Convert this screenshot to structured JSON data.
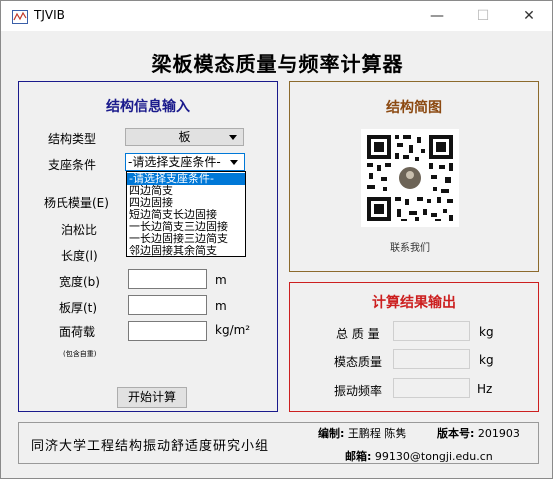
{
  "window": {
    "title": "TJVIB",
    "min_glyph": "—",
    "max_glyph": "☐",
    "close_glyph": "✕"
  },
  "main_title": "梁板模态质量与频率计算器",
  "input_panel": {
    "title": "结构信息输入",
    "structure_type_label": "结构类型",
    "structure_type_value": "板",
    "support_label": "支座条件",
    "support_value": "-请选择支座条件-",
    "support_options": [
      "-请选择支座条件-",
      "四边简支",
      "四边固接",
      "短边简支长边固接",
      "一长边简支三边固接",
      "一长边固接三边简支",
      "邻边固接其余简支"
    ],
    "youngs_label": "杨氏模量(E)",
    "poisson_label": "泊松比",
    "length_label": "长度(l)",
    "width_label": "宽度(b)",
    "width_unit": "m",
    "thickness_label": "板厚(t)",
    "thickness_unit": "m",
    "load_label": "面荷载",
    "load_unit": "kg/m²",
    "load_note": "(包含自重)",
    "calc_button": "开始计算"
  },
  "diagram_panel": {
    "title": "结构简图",
    "caption": "联系我们"
  },
  "output_panel": {
    "title": "计算结果输出",
    "total_mass_label": "总 质 量",
    "total_mass_unit": "kg",
    "modal_mass_label": "模态质量",
    "modal_mass_unit": "kg",
    "frequency_label": "振动频率",
    "frequency_unit": "Hz"
  },
  "footer": {
    "group": "同济大学工程结构振动舒适度研究小组",
    "editors_label": "编制:",
    "editors": "王鹏程 陈隽",
    "version_label": "版本号:",
    "version": "201903",
    "email_label": "邮箱:",
    "email": "99130@tongji.edu.cn"
  }
}
